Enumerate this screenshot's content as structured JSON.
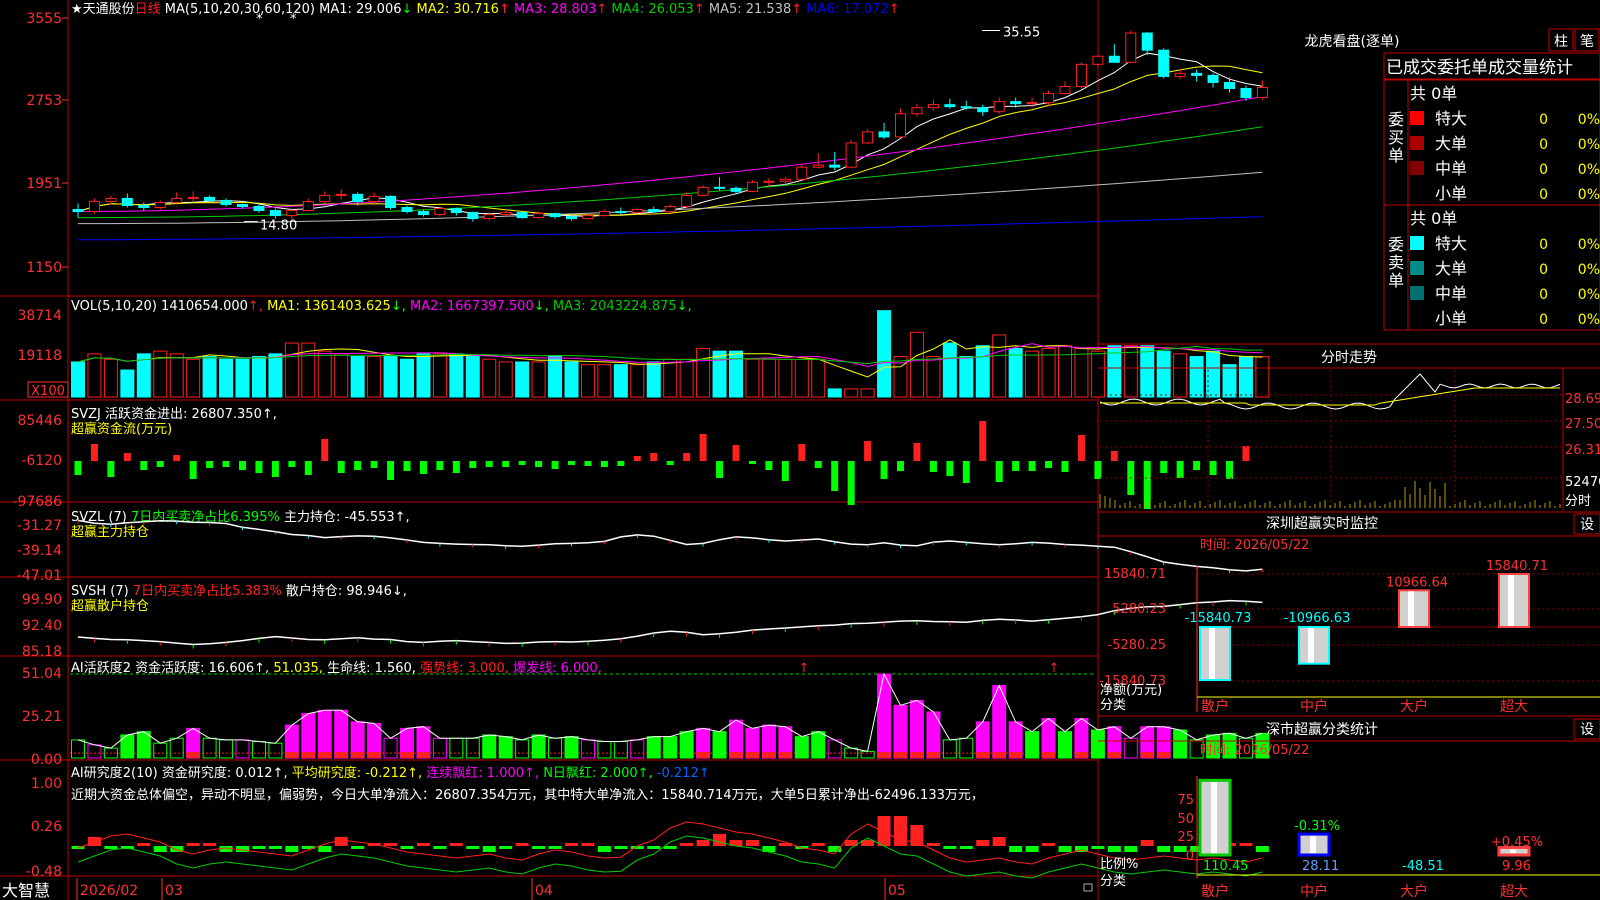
{
  "colors": {
    "up": "#ff2020",
    "down": "#00ffff",
    "ma1": "#ffffff",
    "ma2": "#ffff00",
    "ma3": "#ff00ff",
    "ma4": "#00cc00",
    "ma5": "#c0c0c0",
    "ma6": "#0000ff",
    "border": "#c00000",
    "axisRed": "#ff3030",
    "green": "#00ff00",
    "yellow": "#ffff00",
    "magenta": "#ff00ff"
  },
  "stock": {
    "title": "★天通股份",
    "period": "日线",
    "ma_params": "MA(5,10,20,30,60,120)",
    "ma_labels": [
      {
        "text": "MA1: 29.006",
        "arrow": "↓",
        "color": "#ffffff"
      },
      {
        "text": "MA2: 30.716",
        "arrow": "↑",
        "color": "#ffff00"
      },
      {
        "text": "MA3: 28.803",
        "arrow": "↑",
        "color": "#ff00ff"
      },
      {
        "text": "MA4: 26.053",
        "arrow": "↑",
        "color": "#00cc00"
      },
      {
        "text": "MA5: 21.538",
        "arrow": "↑",
        "color": "#c0c0c0"
      },
      {
        "text": "MA6: 17.072",
        "arrow": "↑",
        "color": "#0000ff"
      }
    ],
    "price_axis": [
      "3555",
      "2753",
      "1951",
      "1150"
    ],
    "high_label": "35.55",
    "low_label": "14.80",
    "candles": [
      [
        17.8,
        18.4,
        17.0,
        17.6
      ],
      [
        17.6,
        18.9,
        17.4,
        18.6
      ],
      [
        18.6,
        19.2,
        18.3,
        18.9
      ],
      [
        18.9,
        19.4,
        18.0,
        18.2
      ],
      [
        18.2,
        18.5,
        17.7,
        18.0
      ],
      [
        18.0,
        18.7,
        17.8,
        18.5
      ],
      [
        18.5,
        19.5,
        18.4,
        18.9
      ],
      [
        18.9,
        19.6,
        18.6,
        19.0
      ],
      [
        19.0,
        19.2,
        18.6,
        18.7
      ],
      [
        18.7,
        18.9,
        18.1,
        18.3
      ],
      [
        18.3,
        18.4,
        17.9,
        18.1
      ],
      [
        18.1,
        18.4,
        17.5,
        17.7
      ],
      [
        17.7,
        17.9,
        16.9,
        17.2
      ],
      [
        17.2,
        17.9,
        16.8,
        17.7
      ],
      [
        17.7,
        18.9,
        17.6,
        18.6
      ],
      [
        18.6,
        19.6,
        18.4,
        19.2
      ],
      [
        19.2,
        19.8,
        18.8,
        19.3
      ],
      [
        19.3,
        19.5,
        18.2,
        18.6
      ],
      [
        18.6,
        19.5,
        18.2,
        19.1
      ],
      [
        19.1,
        19.2,
        17.8,
        18.0
      ],
      [
        18.0,
        18.2,
        17.4,
        17.6
      ],
      [
        17.6,
        17.8,
        17.1,
        17.3
      ],
      [
        17.3,
        18.1,
        17.1,
        17.9
      ],
      [
        17.9,
        18.0,
        17.2,
        17.5
      ],
      [
        17.5,
        17.6,
        16.6,
        16.9
      ],
      [
        16.9,
        17.5,
        16.7,
        17.3
      ],
      [
        17.3,
        17.8,
        17.1,
        17.5
      ],
      [
        17.5,
        17.6,
        16.9,
        17.0
      ],
      [
        17.0,
        17.6,
        16.9,
        17.4
      ],
      [
        17.4,
        17.5,
        16.9,
        17.1
      ],
      [
        17.1,
        17.4,
        16.7,
        16.9
      ],
      [
        16.9,
        17.3,
        16.8,
        17.2
      ],
      [
        17.2,
        17.8,
        17.1,
        17.6
      ],
      [
        17.6,
        18.0,
        17.3,
        17.5
      ],
      [
        17.5,
        18.0,
        17.4,
        17.8
      ],
      [
        17.8,
        18.1,
        17.5,
        17.6
      ],
      [
        17.6,
        18.3,
        17.5,
        18.1
      ],
      [
        18.1,
        19.5,
        18.0,
        19.2
      ],
      [
        19.2,
        20.2,
        19.1,
        20.0
      ],
      [
        20.0,
        21.0,
        19.7,
        19.9
      ],
      [
        19.9,
        20.1,
        19.3,
        19.6
      ],
      [
        19.6,
        20.7,
        19.5,
        20.5
      ],
      [
        20.5,
        20.9,
        20.1,
        20.6
      ],
      [
        20.6,
        21.0,
        20.3,
        20.8
      ],
      [
        20.8,
        22.2,
        20.7,
        22.0
      ],
      [
        22.0,
        23.4,
        21.9,
        22.2
      ],
      [
        22.2,
        23.5,
        21.7,
        22.0
      ],
      [
        22.0,
        24.7,
        21.9,
        24.4
      ],
      [
        24.4,
        25.8,
        24.3,
        25.5
      ],
      [
        25.5,
        26.4,
        24.8,
        25.0
      ],
      [
        25.0,
        27.8,
        24.9,
        27.3
      ],
      [
        27.3,
        28.3,
        27.0,
        27.9
      ],
      [
        27.9,
        28.7,
        27.6,
        28.2
      ],
      [
        28.2,
        28.8,
        27.8,
        28.0
      ],
      [
        28.0,
        28.6,
        27.7,
        27.9
      ],
      [
        27.9,
        28.2,
        27.1,
        27.5
      ],
      [
        27.5,
        28.9,
        27.3,
        28.5
      ],
      [
        28.5,
        28.9,
        27.9,
        28.3
      ],
      [
        28.3,
        28.9,
        27.9,
        28.4
      ],
      [
        28.4,
        29.6,
        28.1,
        29.3
      ],
      [
        29.3,
        30.5,
        29.2,
        30.0
      ],
      [
        30.0,
        32.4,
        29.8,
        32.2
      ],
      [
        32.2,
        33.1,
        32.0,
        33.0
      ],
      [
        33.0,
        34.2,
        32.5,
        32.4
      ],
      [
        32.4,
        35.55,
        32.3,
        35.3
      ],
      [
        35.3,
        35.4,
        33.1,
        33.6
      ],
      [
        33.6,
        33.8,
        30.8,
        31.0
      ],
      [
        31.0,
        31.7,
        30.7,
        31.3
      ],
      [
        31.3,
        31.7,
        30.5,
        31.1
      ],
      [
        31.1,
        31.3,
        29.9,
        30.4
      ],
      [
        30.4,
        30.9,
        29.4,
        29.8
      ],
      [
        29.8,
        30.1,
        28.6,
        28.9
      ],
      [
        28.9,
        30.6,
        28.7,
        29.9
      ]
    ]
  },
  "volume": {
    "label": "VOL(5,10,20)",
    "value": "1410654.000",
    "items": [
      {
        "text": "MA1: 1361403.625",
        "arrow": "↓",
        "color": "#ffff00"
      },
      {
        "text": "MA2: 1667397.500",
        "arrow": "↓",
        "color": "#ff00ff"
      },
      {
        "text": "MA3: 2043224.875",
        "arrow": "↓",
        "color": "#00cc00"
      }
    ],
    "axis": [
      "38714",
      "19118"
    ],
    "unit": "X100",
    "values": [
      13,
      16,
      14,
      10,
      16,
      17,
      16,
      14,
      15,
      14,
      14,
      15,
      16,
      20,
      20,
      17,
      16,
      15,
      15,
      15,
      14,
      16,
      16,
      16,
      15,
      14,
      13,
      13,
      13,
      15,
      13,
      12,
      12,
      12,
      12,
      13,
      14,
      14,
      18,
      17,
      17,
      14,
      14,
      14,
      14,
      14,
      3,
      3,
      3,
      32,
      15,
      24,
      15,
      20,
      15,
      19,
      23,
      18,
      17,
      18,
      19,
      18,
      17,
      19,
      19,
      19,
      17,
      16,
      15,
      17,
      12,
      15,
      15
    ]
  },
  "svzj": {
    "label": "SVZJ",
    "title": "活跃资金进出: 26807.350↑,",
    "subtitle": "超赢资金流(万元)",
    "axis": [
      "85446",
      "-6120",
      "-97686"
    ],
    "values": [
      -14,
      17,
      -16,
      8,
      -9,
      -6,
      6,
      -18,
      -7,
      -6,
      -9,
      -12,
      -16,
      -6,
      -14,
      22,
      -12,
      -9,
      -7,
      -19,
      -10,
      -13,
      -9,
      -12,
      -7,
      -6,
      -6,
      -4,
      -6,
      -8,
      -4,
      -5,
      -6,
      -5,
      5,
      8,
      -4,
      8,
      27,
      -17,
      16,
      -3,
      -9,
      -20,
      17,
      -7,
      -30,
      -44,
      20,
      -18,
      -10,
      18,
      -11,
      -15,
      -22,
      40,
      -21,
      -10,
      -10,
      -7,
      -11,
      26,
      -18,
      10,
      -34,
      -48,
      -12,
      -17,
      -9,
      -14,
      -18,
      15
    ]
  },
  "svzl": {
    "label": "SVZL (7)",
    "title": "7日内买卖净占比6.395%",
    "extra": "主力持仓: -45.553↑,",
    "subtitle": "超赢主力持仓",
    "axis": [
      "-31.27",
      "-39.14",
      "-47.01"
    ],
    "values": [
      -31.4,
      -32.2,
      -32.5,
      -32.1,
      -31.8,
      -31.5,
      -31.6,
      -31.9,
      -32.0,
      -32.3,
      -33.4,
      -34.0,
      -34.7,
      -35.5,
      -35.8,
      -36.4,
      -36.1,
      -35.9,
      -36.0,
      -36.5,
      -37.1,
      -37.8,
      -38.1,
      -38.3,
      -38.4,
      -38.5,
      -38.8,
      -38.9,
      -38.6,
      -38.2,
      -38.1,
      -37.9,
      -37.5,
      -36.2,
      -35.6,
      -36.0,
      -37.2,
      -38.4,
      -38.1,
      -37.0,
      -36.2,
      -36.5,
      -37.0,
      -37.4,
      -37.1,
      -36.8,
      -37.6,
      -38.3,
      -38.5,
      -37.9,
      -38.6,
      -38.8,
      -37.7,
      -37.4,
      -37.8,
      -38.2,
      -38.5,
      -38.2,
      -37.8,
      -38.0,
      -38.4,
      -38.6,
      -38.9,
      -39.2,
      -40.5,
      -42.0,
      -43.5,
      -44.2,
      -44.8,
      -45.2,
      -45.8,
      -46.1,
      -45.6
    ]
  },
  "svsh": {
    "label": "SVSH (7)",
    "title": "7日内买卖净占比5.383%",
    "extra": "散户持仓: 98.946↓,",
    "subtitle": "超赢散户持仓",
    "axis": [
      "99.90",
      "92.40",
      "85.18"
    ],
    "values": [
      88.8,
      88.4,
      88.1,
      88.0,
      87.8,
      87.5,
      87.1,
      86.7,
      86.9,
      87.3,
      87.8,
      88.4,
      88.9,
      88.5,
      88.1,
      88.0,
      88.3,
      88.6,
      88.2,
      88.1,
      87.5,
      87.3,
      87.6,
      87.8,
      87.5,
      87.3,
      87.0,
      87.1,
      87.4,
      87.5,
      87.4,
      87.6,
      87.9,
      88.3,
      89.0,
      89.9,
      90.4,
      90.1,
      89.4,
      89.7,
      90.1,
      90.7,
      91.0,
      91.3,
      91.6,
      91.9,
      92.1,
      92.5,
      92.6,
      92.9,
      93.2,
      93.3,
      93.1,
      93.0,
      92.9,
      93.4,
      93.7,
      93.5,
      93.2,
      93.6,
      94.0,
      94.4,
      95.0,
      96.1,
      96.8,
      97.2,
      97.3,
      97.8,
      98.3,
      98.5,
      98.9,
      98.7,
      98.4
    ]
  },
  "ai": {
    "label": "AI活跃度2",
    "title": "资金活跃度: 16.606↑,",
    "v2": "51.035,",
    "life": "生命线: 1.560,",
    "strong": "强势线: 3.000,",
    "burst": "爆发线: 6.000,",
    "axis": [
      "51.04",
      "25.21",
      "0.00"
    ],
    "values": [
      11,
      8,
      6,
      14,
      16,
      9,
      12,
      18,
      12,
      11,
      11,
      10,
      9,
      20,
      27,
      29,
      29,
      22,
      21,
      12,
      18,
      19,
      12,
      12,
      12,
      14,
      13,
      11,
      14,
      12,
      13,
      11,
      10,
      10,
      11,
      13,
      13,
      16,
      18,
      16,
      23,
      18,
      20,
      19,
      13,
      16,
      11,
      6,
      4,
      51,
      32,
      35,
      28,
      11,
      12,
      22,
      44,
      22,
      16,
      24,
      16,
      24,
      17,
      19,
      12,
      19,
      19,
      17,
      11,
      14,
      15,
      12,
      15
    ]
  },
  "research": {
    "label": "AI研究度2(10)",
    "title": "资金研究度: 0.012↑,",
    "avg": "平均研究度: -0.212↑,",
    "red": "连续飘红: 1.000↑,",
    "nred": "N日飘红: 2.000↑,",
    "last": "-0.212↑",
    "comment": "近期大资金总体偏空，异动不明显，偏弱势，今日大单净流入：26807.354万元，其中特大单净流入：15840.714万元，大单5日累计净出-62496.133万元，",
    "axis": [
      "1.00",
      "0.26",
      "-0.48"
    ],
    "bars": [
      -1,
      3,
      -1,
      -1,
      1,
      -2,
      -2,
      1,
      1,
      -2,
      -2,
      -1,
      -1,
      -2,
      -1,
      -2,
      3,
      -1,
      1,
      1,
      -1,
      1,
      -1,
      1,
      -1,
      -2,
      -1,
      1,
      -1,
      -1,
      1,
      1,
      -2,
      -1,
      -1,
      -1,
      -1,
      1,
      2,
      4,
      2,
      2,
      -2,
      1,
      -1,
      1,
      -2,
      2,
      2,
      10,
      10,
      7,
      1,
      -1,
      -1,
      2,
      3,
      -2,
      -2,
      1,
      -2,
      -2,
      -1,
      -2,
      -2,
      2,
      -2,
      -2,
      -2,
      -2,
      1,
      1,
      -2
    ],
    "line": [
      -0.05,
      0.1,
      0.25,
      0.3,
      0.2,
      0.1,
      -0.1,
      -0.2,
      -0.1,
      -0.05,
      -0.1,
      -0.15,
      -0.2,
      -0.25,
      -0.1,
      0.05,
      0.15,
      0.1,
      0.05,
      -0.05,
      -0.15,
      -0.2,
      -0.25,
      -0.3,
      -0.25,
      -0.2,
      -0.3,
      -0.35,
      -0.2,
      -0.1,
      -0.15,
      -0.25,
      -0.3,
      -0.28,
      0.0,
      0.15,
      0.45,
      0.6,
      0.55,
      0.45,
      0.35,
      0.3,
      0.2,
      0.1,
      -0.05,
      -0.1,
      -0.2,
      0.3,
      0.55,
      0.35,
      0.15,
      0.1,
      -0.1,
      -0.3,
      -0.4,
      -0.35,
      -0.3,
      -0.4,
      -0.45,
      -0.3,
      -0.2,
      -0.1,
      -0.2,
      -0.3,
      -0.35,
      -0.3,
      -0.25,
      -0.3,
      -0.35,
      -0.3,
      -0.35,
      -0.4,
      -0.3
    ]
  },
  "date_axis": {
    "labels": [
      "2026/02",
      "03",
      "04",
      "05"
    ]
  },
  "footer": {
    "brand": "大智慧"
  },
  "right": {
    "dragon_title": "龙虎看盘(逐单)",
    "btn_zhu": "柱",
    "btn_bi": "笔",
    "tabs": [
      "已成交",
      "委托单",
      "成交量",
      "统计"
    ],
    "buy_group": {
      "label": [
        "委",
        "买",
        "单"
      ],
      "total": "共 0单",
      "rows": [
        {
          "name": "特大",
          "color": "#ff0000",
          "v": "0",
          "pct": "0%"
        },
        {
          "name": "大单",
          "color": "#aa0000",
          "v": "0",
          "pct": "0%"
        },
        {
          "name": "中单",
          "color": "#800000",
          "v": "0",
          "pct": "0%"
        },
        {
          "name": "小单",
          "color": "",
          "v": "0",
          "pct": "0%"
        }
      ]
    },
    "sell_group": {
      "label": [
        "委",
        "卖",
        "单"
      ],
      "total": "共 0单",
      "rows": [
        {
          "name": "特大",
          "color": "#00ffff",
          "v": "0",
          "pct": "0%"
        },
        {
          "name": "大单",
          "color": "#008b8b",
          "v": "0",
          "pct": "0%"
        },
        {
          "name": "中单",
          "color": "#007070",
          "v": "0",
          "pct": "0%"
        },
        {
          "name": "小单",
          "color": "",
          "v": "0",
          "pct": "0%"
        }
      ]
    },
    "intraday": {
      "title": "分时走势",
      "axis": [
        "28.69",
        "27.50",
        "26.31",
        "52476",
        "分时"
      ]
    },
    "monitor": {
      "title": "深圳超赢实时监控",
      "settings": "设",
      "time": "时间: 2026/05/22",
      "axis": [
        "15840.71",
        "5280.23",
        "-5280.25",
        "-15840.73"
      ],
      "ylabel": "净额(万元)",
      "xlabel": "分类",
      "categories": [
        "散户",
        "中户",
        "大户",
        "超大"
      ],
      "values": [
        -15840.73,
        -10966.63,
        10966.64,
        15840.71
      ],
      "value_labels": [
        "-15840.73",
        "-10966.63",
        "10966.64",
        "15840.71"
      ]
    },
    "classify": {
      "title": "深市超赢分类统计",
      "settings": "设",
      "time": "时间: 2026/05/22",
      "axis": [
        "75",
        "50",
        "25",
        "0"
      ],
      "ylabel": "比例%",
      "xlabel": "分类",
      "categories": [
        "散户",
        "中户",
        "大户",
        "超大"
      ],
      "top_labels": [
        "",
        "-0.31%",
        "",
        "+0.45%"
      ],
      "bottom_labels": [
        "110.45",
        "28.11",
        "-48.51",
        "9.96"
      ],
      "heights": [
        100,
        28,
        0,
        10
      ]
    }
  }
}
